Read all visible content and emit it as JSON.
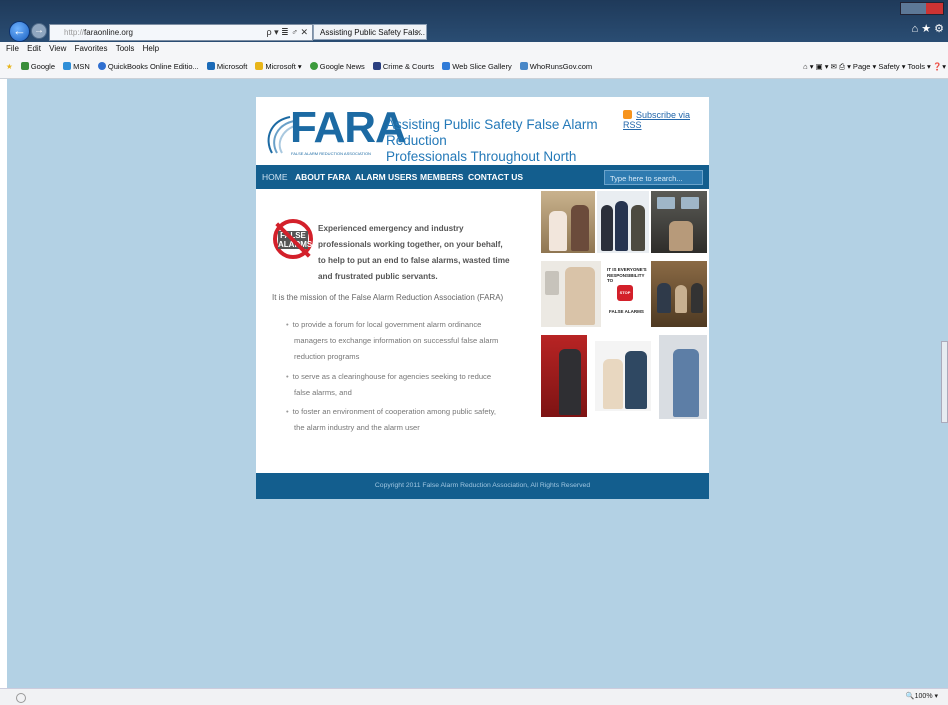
{
  "browser": {
    "url_protocol": "http://",
    "url_host": "faraonline.org",
    "address_icons": "ρ ▾ ≣ ♂ ✕",
    "tab_title": "Assisting Public Safety Fals...",
    "tab_close": "✕",
    "right_tools": "⌂ ★ ⚙",
    "menu": [
      "File",
      "Edit",
      "View",
      "Favorites",
      "Tools",
      "Help"
    ],
    "favorites": [
      {
        "label": "Google",
        "color": "#3a8e3a"
      },
      {
        "label": "MSN",
        "color": "#2f8fd8"
      },
      {
        "label": "QuickBooks Online Editio...",
        "color": "#2f6fd0"
      },
      {
        "label": "Microsoft",
        "color": "#1b6bb8"
      },
      {
        "label": "Microsoft ▾",
        "color": "#e8b51a"
      },
      {
        "label": "Google News",
        "color": "#3c9a3c"
      },
      {
        "label": "Crime & Courts",
        "color": "#2a3f80"
      },
      {
        "label": "Web Slice Gallery",
        "color": "#2f7bd8"
      },
      {
        "label": "WhoRunsGov.com",
        "color": "#4a88c8"
      }
    ],
    "command_bar": "⌂ ▾  ▣ ▾  ✉  ⎙ ▾  Page ▾  Safety ▾  Tools ▾  ❓▾",
    "zoom": "🔍100%  ▾"
  },
  "site": {
    "logo": "FARA",
    "logo_sub": "FALSE ALARM REDUCTION ASSOCIATION",
    "tagline_1": "Assisting Public Safety False Alarm Reduction",
    "tagline_2": "Professionals Throughout North America",
    "rss": "Subscribe via RSS",
    "nav": [
      "HOME",
      "ABOUT FARA",
      "ALARM USERS",
      "MEMBERS",
      "CONTACT US"
    ],
    "search_placeholder": "Type here to search...",
    "no_false_alarms_badge": "FALSE ALARMS",
    "intro_1": "Experienced emergency and industry",
    "intro_2": "professionals working together, on your behalf,",
    "intro_3": "to help to put an end to false alarms, wasted time",
    "intro_4": "and frustrated public servants.",
    "mission": "It is the mission of the False Alarm Reduction Association (FARA)",
    "bullets": [
      [
        "to provide a forum for local government alarm ordinance",
        "managers to exchange information on successful false alarm",
        "reduction programs"
      ],
      [
        "to serve as a clearinghouse for agencies seeking to reduce",
        "false alarms, and"
      ],
      [
        "to foster an environment of cooperation among public safety,",
        "the alarm industry and the alarm user"
      ]
    ],
    "poster_1": "IT IS EVERYONE'S",
    "poster_2": "RESPONSIBILITY TO",
    "poster_stop": "STOP",
    "poster_3": "FALSE ALARMS",
    "footer": "Copyright 2011 False Alarm Reduction Association, All Rights Reserved"
  }
}
